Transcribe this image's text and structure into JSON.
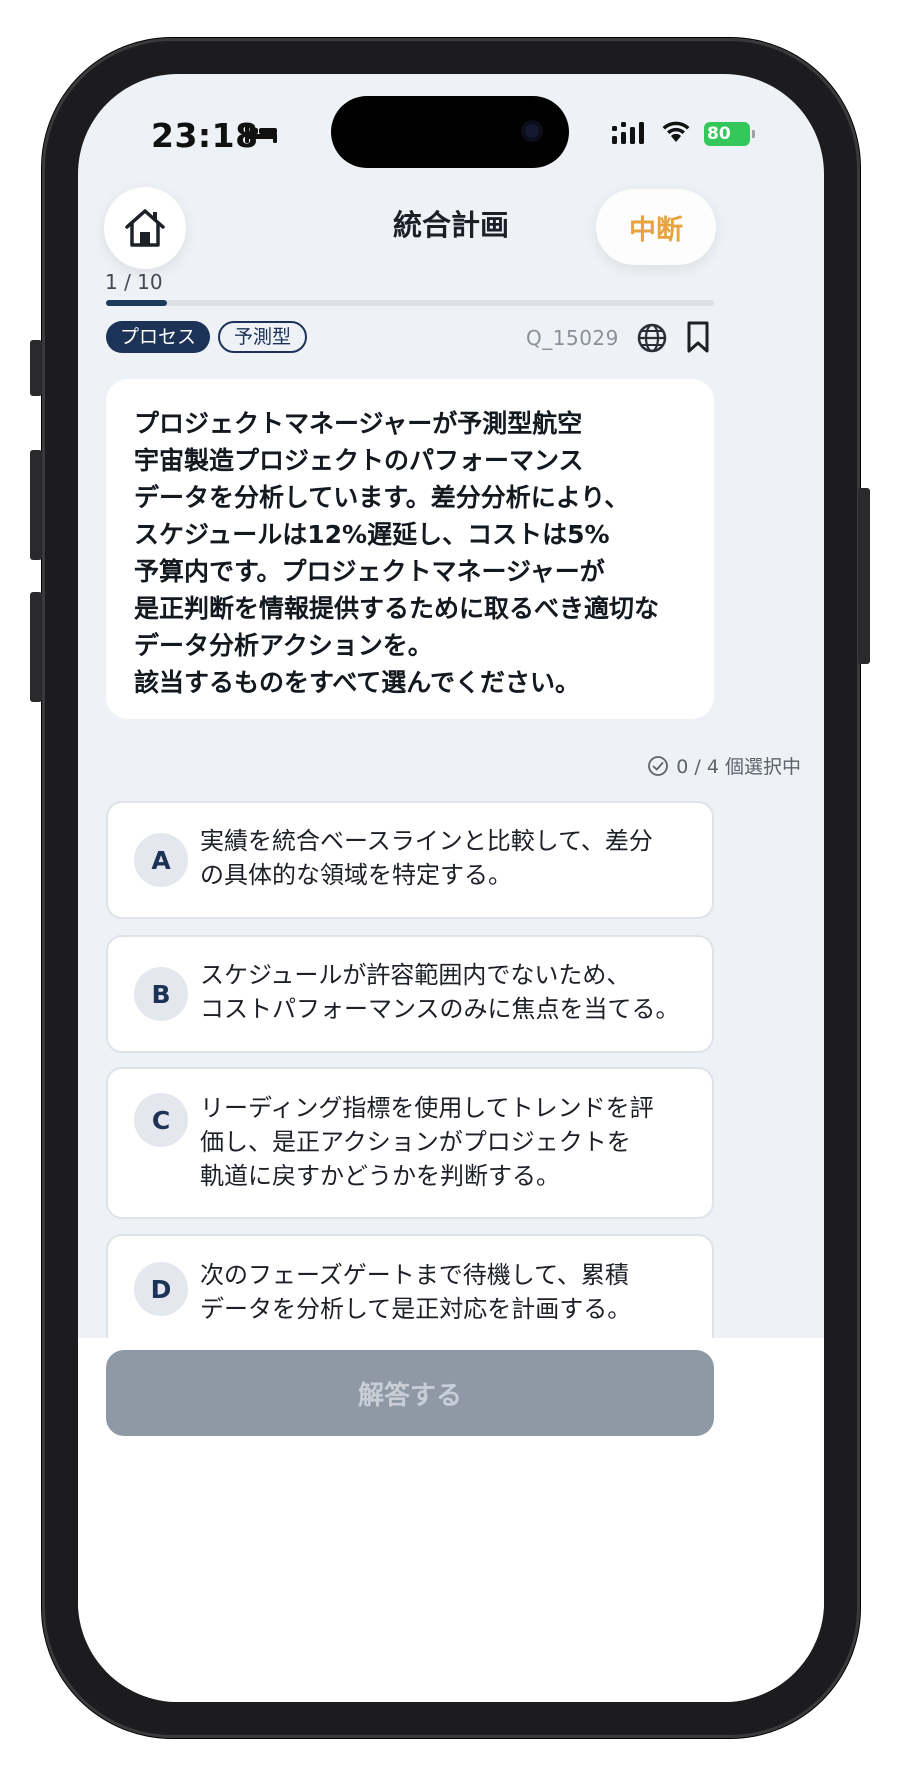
{
  "status_bar": {
    "time": "23:18",
    "battery": "80"
  },
  "header": {
    "title": "統合計画",
    "suspend_label": "中断"
  },
  "progress": {
    "label": "1 / 10",
    "fraction": 0.1
  },
  "tags": [
    "プロセス",
    "予測型"
  ],
  "question": {
    "id": "Q_15029",
    "text": "プロジェクトマネージャーが予測型航空\n宇宙製造プロジェクトのパフォーマンス\nデータを分析しています。差分分析により、\nスケジュールは12%遅延し、コストは5%\n予算内です。プロジェクトマネージャーが\n是正判断を情報提供するために取るべき適切な\nデータ分析アクションを。\n該当するものをすべて選んでください。"
  },
  "selection": {
    "counter": "0 / 4 個選択中"
  },
  "options": [
    {
      "letter": "A",
      "text": "実績を統合ベースラインと比較して、差分\nの具体的な領域を特定する。"
    },
    {
      "letter": "B",
      "text": "スケジュールが許容範囲内でないため、\nコストパフォーマンスのみに焦点を当てる。"
    },
    {
      "letter": "C",
      "text": "リーディング指標を使用してトレンドを評\n価し、是正アクションがプロジェクトを\n軌道に戻すかどうかを判断する。"
    },
    {
      "letter": "D",
      "text": "次のフェーズゲートまで待機して、累積\nデータを分析して是正対応を計画する。"
    }
  ],
  "footer": {
    "answer_label": "解答する"
  },
  "colors": {
    "accent": "#1c3257",
    "suspend": "#e8a33c",
    "answer_disabled": "#8f98a5"
  }
}
